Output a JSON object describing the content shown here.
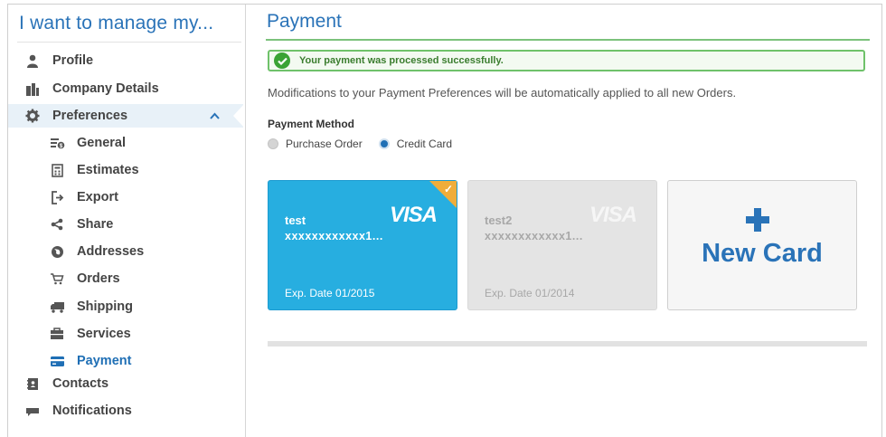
{
  "sidebar": {
    "title": "I want to manage my...",
    "items": [
      {
        "label": "Profile",
        "icon": "person-icon"
      },
      {
        "label": "Company Details",
        "icon": "buildings-icon"
      },
      {
        "label": "Preferences",
        "icon": "gear-icon"
      },
      {
        "label": "General",
        "icon": "general-settings-icon"
      },
      {
        "label": "Estimates",
        "icon": "calculator-icon"
      },
      {
        "label": "Export",
        "icon": "export-icon"
      },
      {
        "label": "Share",
        "icon": "share-icon"
      },
      {
        "label": "Addresses",
        "icon": "globe-icon"
      },
      {
        "label": "Orders",
        "icon": "cart-icon"
      },
      {
        "label": "Shipping",
        "icon": "truck-icon"
      },
      {
        "label": "Services",
        "icon": "services-icon"
      },
      {
        "label": "Payment",
        "icon": "credit-card-icon"
      },
      {
        "label": "Contacts",
        "icon": "address-book-icon"
      },
      {
        "label": "Notifications",
        "icon": "speech-bubble-icon"
      }
    ]
  },
  "main": {
    "title": "Payment",
    "alert": "Your payment was processed successfully.",
    "note": "Modifications to your Payment Preferences will be automatically applied to all new Orders.",
    "payment_method_label": "Payment Method",
    "options": [
      {
        "label": "Purchase Order",
        "selected": false
      },
      {
        "label": "Credit Card",
        "selected": true
      }
    ],
    "cards": [
      {
        "name": "test",
        "number": "xxxxxxxxxxxx1...",
        "brand": "VISA",
        "exp": "Exp. Date 01/2015",
        "selected": true
      },
      {
        "name": "test2",
        "number": "xxxxxxxxxxxx1...",
        "brand": "VISA",
        "exp": "Exp. Date 01/2014",
        "selected": false
      }
    ],
    "new_card_label": "New Card"
  },
  "colors": {
    "accent": "#2a73b8",
    "success": "#3aa335",
    "card_selected": "#27aee0",
    "card_inactive": "#e4e4e4",
    "selected_corner": "#f0ad3a"
  }
}
